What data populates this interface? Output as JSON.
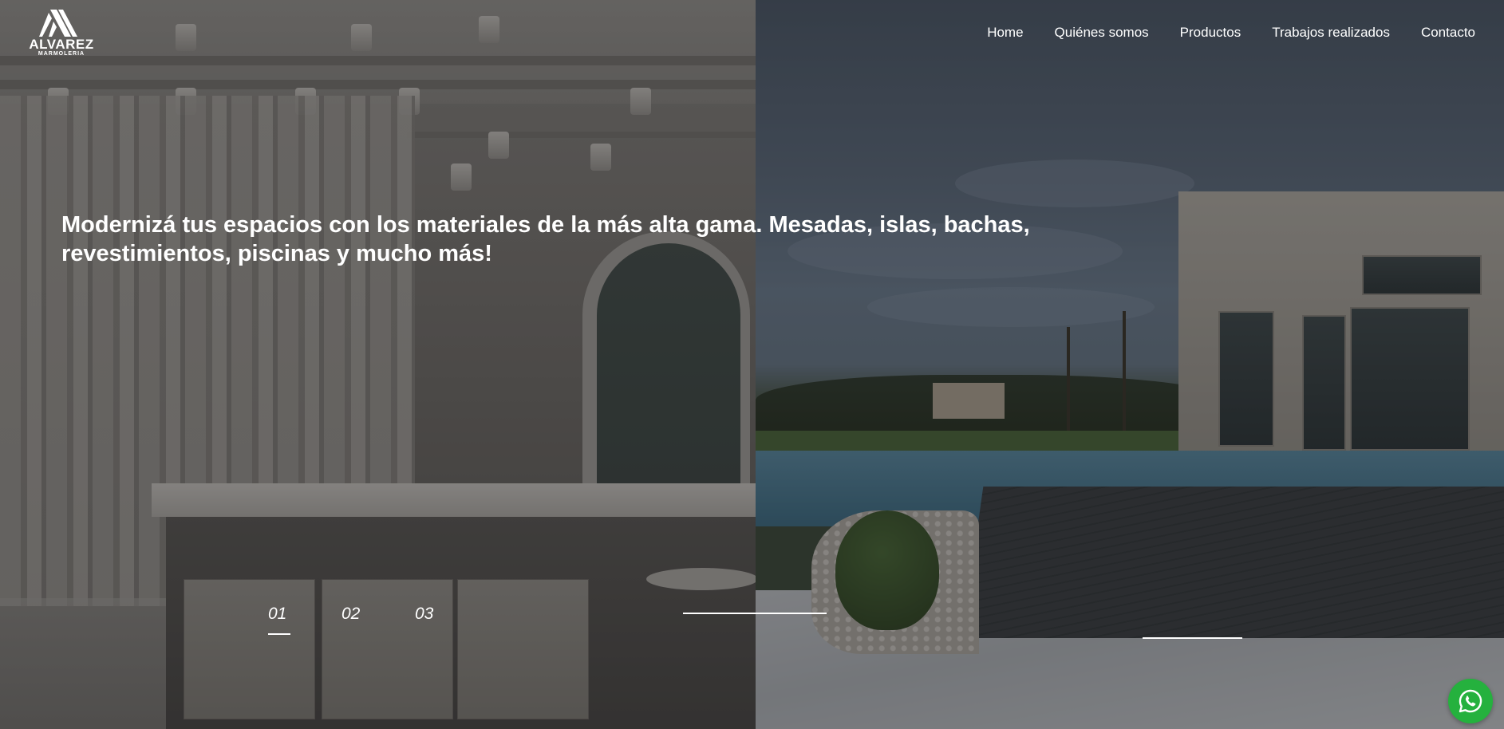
{
  "logo": {
    "brand": "ALVAREZ",
    "subtitle": "MARMOLERIA",
    "icon": "marble-peaks-logo-icon"
  },
  "nav": {
    "items": [
      {
        "label": "Home"
      },
      {
        "label": "Quiénes somos"
      },
      {
        "label": "Productos"
      },
      {
        "label": "Trabajos realizados"
      },
      {
        "label": "Contacto"
      }
    ]
  },
  "hero": {
    "headline": "Modernizá tus espacios con los materiales de la más alta gama. Mesadas, islas, bachas, revestimientos, piscinas y mucho más!",
    "slides": [
      {
        "label": "01",
        "active": true
      },
      {
        "label": "02",
        "active": false
      },
      {
        "label": "03",
        "active": false
      }
    ]
  },
  "whatsapp": {
    "icon": "whatsapp-icon",
    "color": "#25b13e"
  },
  "colors": {
    "overlay": "#161618",
    "text": "#ffffff"
  }
}
